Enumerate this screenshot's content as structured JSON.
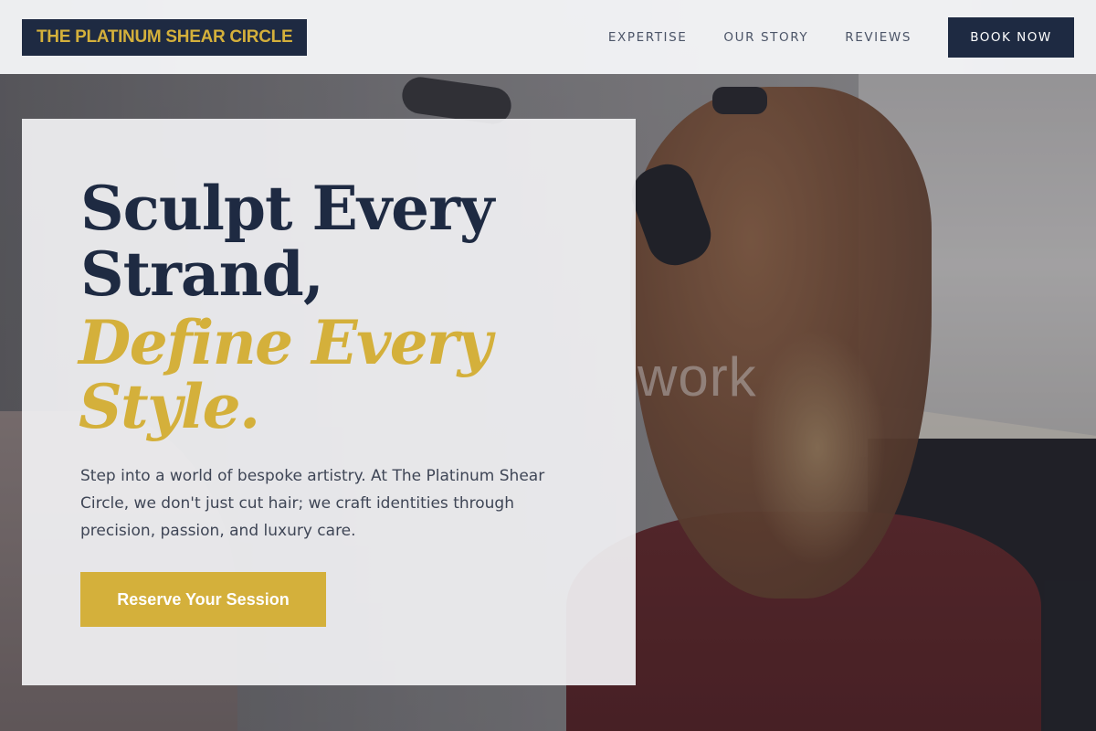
{
  "brand": {
    "name": "THE PLATINUM SHEAR CIRCLE",
    "primary_color": "#1e2a42",
    "accent_color": "#d4b03b"
  },
  "nav": {
    "links": [
      {
        "label": "EXPERTISE"
      },
      {
        "label": "OUR STORY"
      },
      {
        "label": "REVIEWS"
      }
    ],
    "cta_label": "BOOK NOW"
  },
  "hero": {
    "title_lines": [
      "Sculpt Every",
      "Strand,"
    ],
    "accent_lines": [
      "Define Every",
      "Style."
    ],
    "description": "Step into a world of bespoke artistry. At The Platinum Shear Circle, we don't just cut hair; we craft identities through precision, passion, and luxury care.",
    "cta_label": "Reserve Your Session",
    "background_overlay_text": "work"
  }
}
